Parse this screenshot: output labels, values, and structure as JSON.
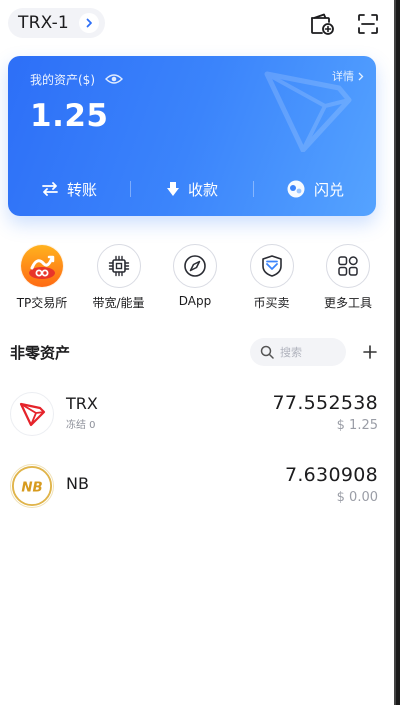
{
  "header": {
    "wallet_name": "TRX-1",
    "icons": [
      "wallet-add-icon",
      "scan-icon"
    ]
  },
  "asset_card": {
    "label": "我的资产($)",
    "detail_label": "详情",
    "balance": "1.25",
    "actions": [
      {
        "label": "转账",
        "icon": "transfer-icon"
      },
      {
        "label": "收款",
        "icon": "receive-icon"
      },
      {
        "label": "闪兑",
        "icon": "swap-icon"
      }
    ],
    "colors": {
      "gradient_start": "#2d6ff7",
      "gradient_end": "#55a3ff"
    }
  },
  "tools": [
    {
      "label": "TP交易所",
      "icon": "tp-exchange-icon"
    },
    {
      "label": "带宽/能量",
      "icon": "chip-icon"
    },
    {
      "label": "DApp",
      "icon": "compass-icon"
    },
    {
      "label": "币买卖",
      "icon": "shield-icon"
    },
    {
      "label": "更多工具",
      "icon": "grid-icon"
    }
  ],
  "assets_section": {
    "title": "非零资产",
    "search_placeholder": "搜索"
  },
  "assets": [
    {
      "symbol": "TRX",
      "sub": "冻结 0",
      "amount": "77.552538",
      "value": "$ 1.25",
      "icon": "trx-logo-icon"
    },
    {
      "symbol": "NB",
      "sub": "",
      "amount": "7.630908",
      "value": "$ 0.00",
      "icon": "nb-logo-icon"
    }
  ]
}
